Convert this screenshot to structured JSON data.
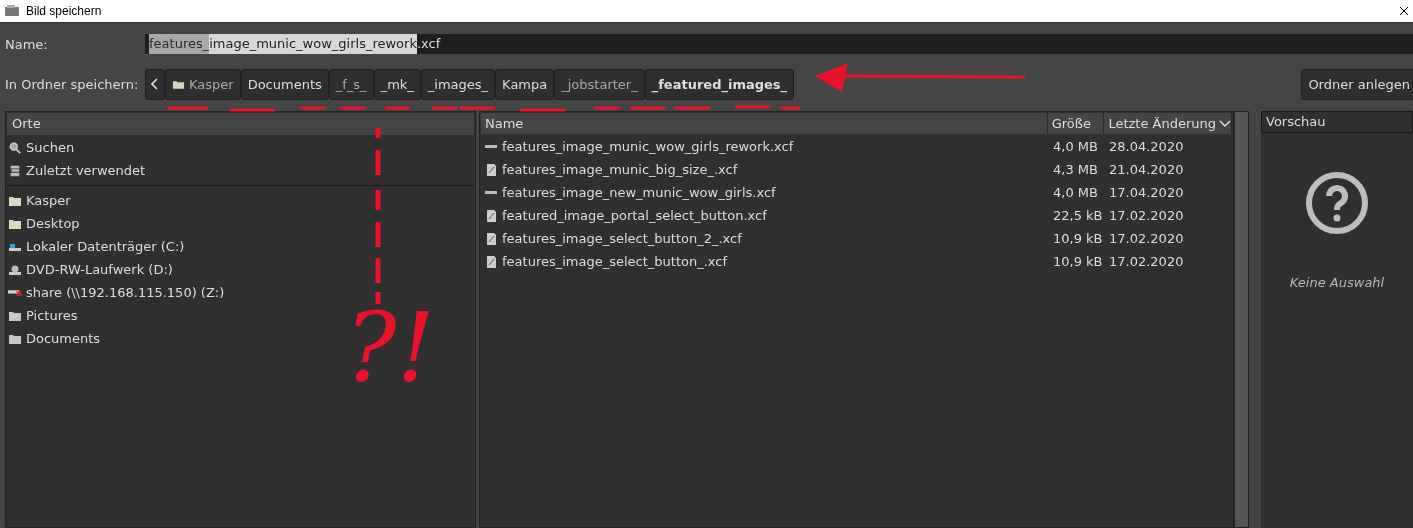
{
  "window": {
    "title": "Bild speichern"
  },
  "name_field": {
    "label": "Name:",
    "parts": [
      {
        "text": "features_",
        "selected": true,
        "redacted": true
      },
      {
        "text": "image_munic_wow_girls_rework",
        "selected": true,
        "redacted": false
      },
      {
        "text": ".xcf",
        "selected": false,
        "redacted": false
      }
    ]
  },
  "folder_bar": {
    "label": "In Ordner speichern:",
    "segments": [
      {
        "text": "Kasper",
        "selected": false,
        "redacted": true,
        "kind": "folder"
      },
      {
        "text": "Documents",
        "selected": false,
        "redacted": false,
        "kind": "plain"
      },
      {
        "text": "_f_s_",
        "selected": false,
        "redacted": true,
        "kind": "plain"
      },
      {
        "text": "_mk_",
        "selected": false,
        "redacted": false,
        "kind": "plain"
      },
      {
        "text": "_images_",
        "selected": false,
        "redacted": false,
        "kind": "plain"
      },
      {
        "text": "Kampa",
        "selected": false,
        "redacted": false,
        "kind": "plain"
      },
      {
        "text": "_jobstarter_",
        "selected": false,
        "redacted": true,
        "kind": "plain"
      },
      {
        "text": "_featured_images_",
        "selected": true,
        "redacted": false,
        "kind": "plain"
      }
    ],
    "create_button": "Ordner anlegen"
  },
  "places": {
    "header": "Orte",
    "items": [
      {
        "label": "Suchen",
        "kind": "search",
        "separator_before": false
      },
      {
        "label": "Zuletzt verwendet",
        "kind": "recent",
        "separator_before": false
      },
      {
        "label": "Kasper",
        "kind": "folder",
        "separator_before": true
      },
      {
        "label": "Desktop",
        "kind": "folder",
        "separator_before": false
      },
      {
        "label": "Lokaler Datenträger (C:)",
        "kind": "drive",
        "separator_before": false
      },
      {
        "label": "DVD-RW-Laufwerk (D:)",
        "kind": "dvd",
        "separator_before": false
      },
      {
        "label": "share (\\\\192.168.115.150) (Z:)",
        "kind": "network",
        "separator_before": false
      },
      {
        "label": "Pictures",
        "kind": "bookmark",
        "separator_before": false
      },
      {
        "label": "Documents",
        "kind": "bookmark",
        "separator_before": false
      }
    ]
  },
  "files": {
    "columns": [
      "Name",
      "Größe",
      "Letzte Änderung"
    ],
    "rows": [
      {
        "name": "features_image_munic_wow_girls_rework.xcf",
        "size": "4,0 MB",
        "date": "28.04.2020",
        "kind": "flat"
      },
      {
        "name": "features_image_munic_big_size_.xcf",
        "size": "4,3 MB",
        "date": "21.04.2020",
        "kind": "doc"
      },
      {
        "name": "features_image_new_munic_wow_girls.xcf",
        "size": "4,0 MB",
        "date": "17.04.2020",
        "kind": "flat"
      },
      {
        "name": "featured_image_portal_select_button.xcf",
        "size": "22,5 kB",
        "date": "17.02.2020",
        "kind": "doc"
      },
      {
        "name": "features_image_select_button_2_.xcf",
        "size": "10,9 kB",
        "date": "17.02.2020",
        "kind": "doc"
      },
      {
        "name": "features_image_select_button_.xcf",
        "size": "10,9 kB",
        "date": "17.02.2020",
        "kind": "doc"
      }
    ]
  },
  "preview": {
    "header": "Vorschau",
    "message": "Keine Auswahl"
  },
  "annotation": {
    "text": "?!"
  }
}
